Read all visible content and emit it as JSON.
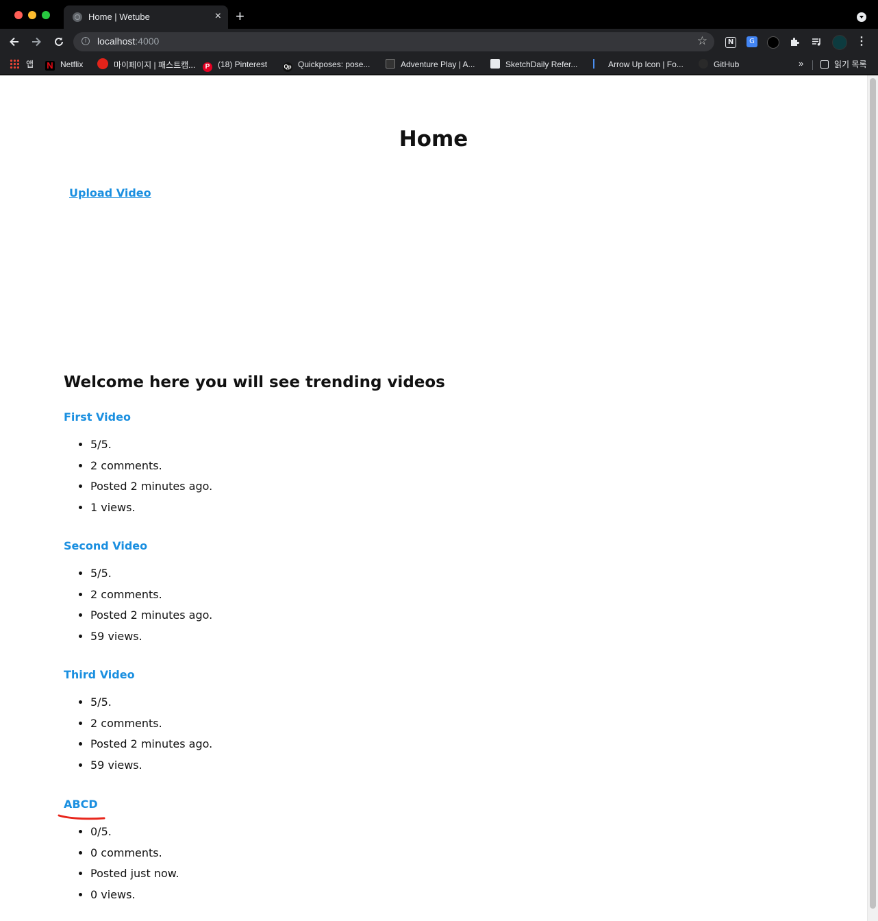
{
  "browser": {
    "tab_title": "Home | Wetube",
    "tab_close": "×",
    "new_tab": "+",
    "url_host": "localhost",
    "url_port": ":4000",
    "bookmarks": [
      {
        "label": "앱"
      },
      {
        "label": "Netflix"
      },
      {
        "label": "마이페이지 | 패스트캠..."
      },
      {
        "label": "(18) Pinterest"
      },
      {
        "label": "Quickposes: pose..."
      },
      {
        "label": "Adventure Play | A..."
      },
      {
        "label": "SketchDaily Refer..."
      },
      {
        "label": "Arrow Up Icon | Fo..."
      },
      {
        "label": "GitHub"
      }
    ],
    "bookmarks_more": "»",
    "reading_list": "읽기 목록"
  },
  "page": {
    "title": "Home",
    "upload_link": "Upload Video",
    "trending_heading": "Welcome here you will see trending videos"
  },
  "videos": [
    {
      "title": "First Video",
      "rating": "5/5.",
      "comments": "2 comments.",
      "posted": "Posted 2 minutes ago.",
      "views": "1 views."
    },
    {
      "title": "Second Video",
      "rating": "5/5.",
      "comments": "2 comments.",
      "posted": "Posted 2 minutes ago.",
      "views": "59 views."
    },
    {
      "title": "Third Video",
      "rating": "5/5.",
      "comments": "2 comments.",
      "posted": "Posted 2 minutes ago.",
      "views": "59 views."
    },
    {
      "title": "ABCD",
      "rating": "0/5.",
      "comments": "0 comments.",
      "posted": "Posted just now.",
      "views": "0 views."
    }
  ],
  "colors": {
    "link": "#1a8fe0",
    "annotation": "#e8261c",
    "chrome_bg": "#202124"
  }
}
